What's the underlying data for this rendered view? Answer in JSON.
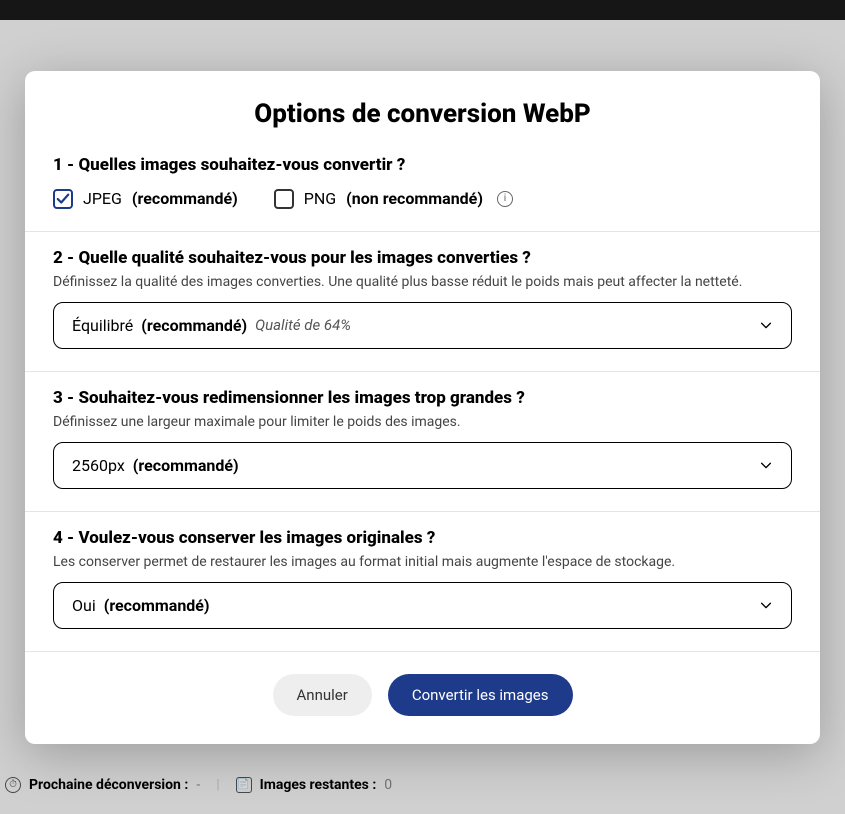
{
  "modal": {
    "title": "Options de conversion WebP",
    "section1": {
      "title": "1 - Quelles images souhaitez-vous convertir ?",
      "jpeg_label": "JPEG",
      "jpeg_rec": "(recommandé)",
      "png_label": "PNG",
      "png_rec": "(non recommandé)"
    },
    "section2": {
      "title": "2 - Quelle qualité souhaitez-vous pour les images converties ?",
      "desc": "Définissez la qualité des images converties. Une qualité plus basse réduit le poids mais peut affecter la netteté.",
      "select_value": "Équilibré",
      "select_rec": "(recommandé)",
      "select_sub": "Qualité de 64%"
    },
    "section3": {
      "title": "3 - Souhaitez-vous redimensionner les images trop grandes ?",
      "desc": "Définissez une largeur maximale pour limiter le poids des images.",
      "select_value": "2560px",
      "select_rec": "(recommandé)"
    },
    "section4": {
      "title": "4 - Voulez-vous conserver les images originales ?",
      "desc": "Les conserver permet de restaurer les images au format initial mais augmente l'espace de stockage.",
      "select_value": "Oui",
      "select_rec": "(recommandé)"
    },
    "footer": {
      "cancel": "Annuler",
      "submit": "Convertir les images"
    }
  },
  "background": {
    "next_deconversion_label": "Prochaine déconversion :",
    "next_deconversion_value": "-",
    "remaining_label": "Images restantes :",
    "remaining_value": "0"
  }
}
